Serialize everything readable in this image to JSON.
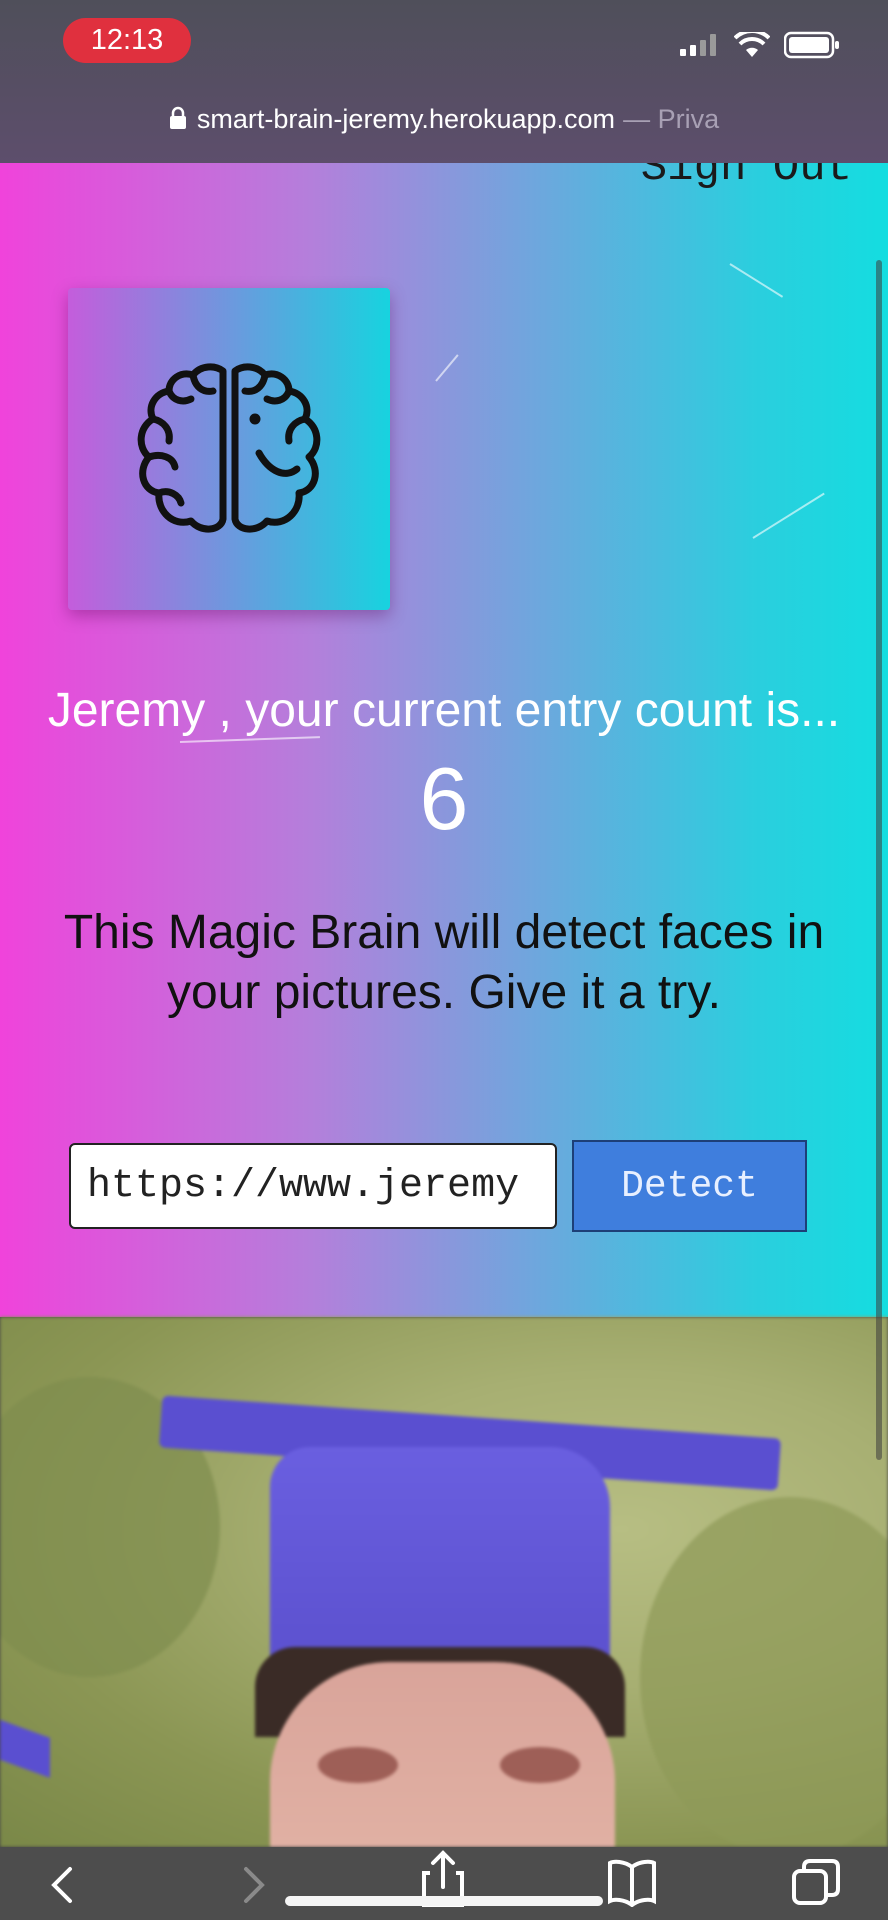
{
  "status_bar": {
    "time": "12:13"
  },
  "address_bar": {
    "domain": "smart-brain-jeremy.herokuapp.com",
    "suffix": "— Priva"
  },
  "nav": {
    "sign_out_label": "Sign Out"
  },
  "logo": {
    "icon": "brain-icon"
  },
  "rank": {
    "message": "Jeremy , your current entry count is...",
    "count": "6"
  },
  "intro": {
    "description": "This Magic Brain will detect faces in your pictures. Give it a try."
  },
  "form": {
    "url_value": "https://www.jeremy",
    "detect_label": "Detect"
  },
  "colors": {
    "gradient_left": "#f043db",
    "gradient_right": "#14dde0",
    "button_blue": "#3f7edd",
    "time_pill_red": "#e0303e"
  }
}
